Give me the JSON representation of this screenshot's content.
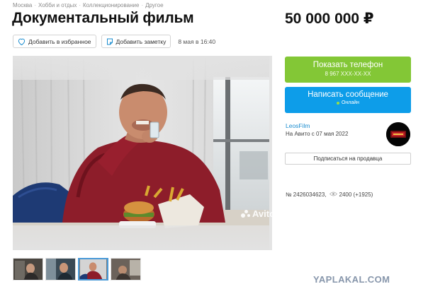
{
  "breadcrumb": [
    "Москва",
    "Хобби и отдых",
    "Коллекционирование",
    "Другое"
  ],
  "listing": {
    "title": "Документальный фильм",
    "price": "50 000 000 ₽",
    "date": "8 мая в 16:40"
  },
  "actions": {
    "favorite_label": "Добавить в избранное",
    "note_label": "Добавить заметку"
  },
  "photo": {
    "watermark": "Avito",
    "thumbnail_count": 4,
    "active_thumbnail": 3
  },
  "contact": {
    "call_label": "Показать телефон",
    "phone_masked": "8 967 XXX-XX-XX",
    "message_label": "Написать сообщение",
    "online_label": "Онлайн"
  },
  "seller": {
    "name": "LeosFilm",
    "since": "На Авито с 07 мая 2022",
    "subscribe_label": "Подписаться на продавца"
  },
  "meta": {
    "ad_number": "№ 2426034623,",
    "views": "2400 (+1925)"
  },
  "site_watermark": "YAPLAKAL.COM",
  "colors": {
    "call_green": "#83c736",
    "message_blue": "#0d9de9",
    "link_blue": "#1a8ccf"
  },
  "icons": {
    "favorite": "heart-icon",
    "note": "note-icon",
    "views": "eye-icon"
  }
}
